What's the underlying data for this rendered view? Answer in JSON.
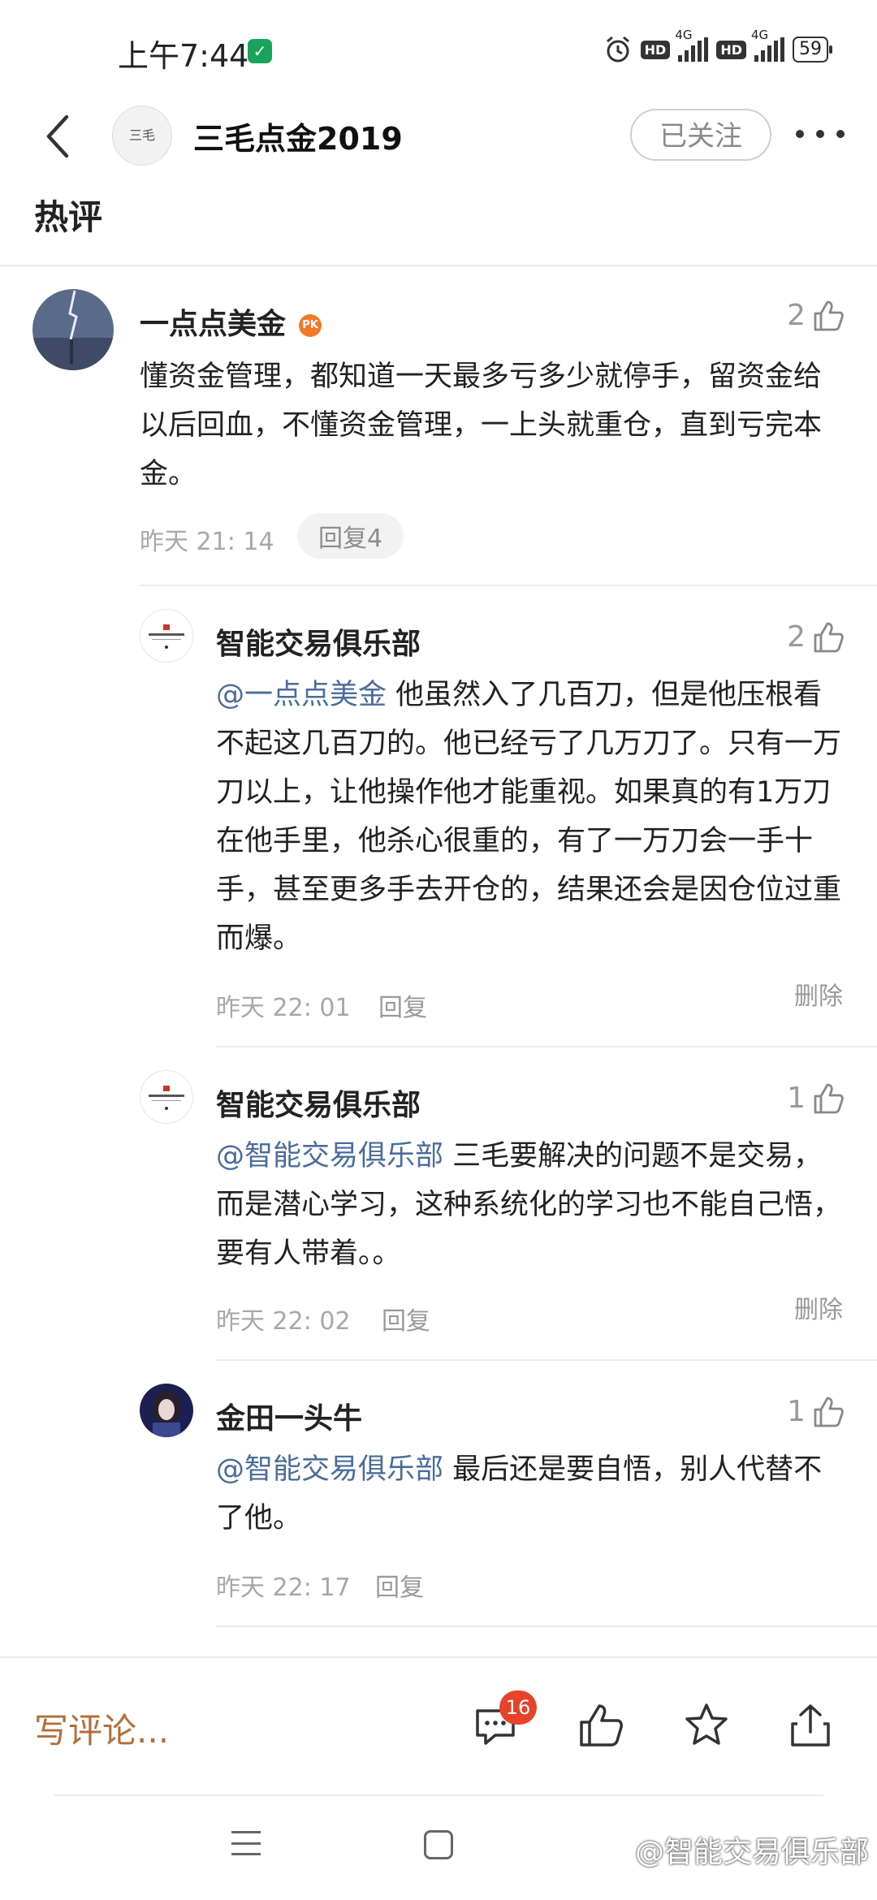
{
  "status_bar": {
    "time": "上午7:44",
    "hd1": "HD",
    "net1": "4G",
    "hd2": "HD",
    "net2": "4G",
    "battery": "59"
  },
  "header": {
    "avatar_text": "三毛",
    "title": "三毛点金2019",
    "follow_label": "已关注",
    "section": "热评"
  },
  "comment": {
    "author": "一点点美金",
    "pk_badge": "PK",
    "likes": "2",
    "text": "懂资金管理，都知道一天最多亏多少就停手，留资金给以后回血，不懂资金管理，一上头就重仓，直到亏完本金。",
    "time": "昨天 21: 14",
    "reply_label": "回复4"
  },
  "replies": [
    {
      "author": "智能交易俱乐部",
      "likes": "2",
      "mention": "@一点点美金",
      "text": " 他虽然入了几百刀，但是他压根看不起这几百刀的。他已经亏了几万刀了。只有一万刀以上，让他操作他才能重视。如果真的有1万刀在他手里，他杀心很重的，有了一万刀会一手十手，甚至更多手去开仓的，结果还会是因仓位过重而爆。",
      "time": "昨天 22: 01",
      "reply_label": "回复",
      "delete_label": "删除"
    },
    {
      "author": "智能交易俱乐部",
      "likes": "1",
      "mention": "@智能交易俱乐部",
      "text": " 三毛要解决的问题不是交易，而是潜心学习，这种系统化的学习也不能自己悟，要有人带着。。",
      "time": "昨天 22: 02",
      "reply_label": "回复",
      "delete_label": "删除"
    },
    {
      "author": "金田一头牛",
      "likes": "1",
      "mention": "@智能交易俱乐部",
      "text": " 最后还是要自悟，别人代替不了他。",
      "time": "昨天 22: 17",
      "reply_label": "回复"
    }
  ],
  "bottom_bar": {
    "write_placeholder": "写评论...",
    "comment_count": "16"
  },
  "watermark": "@智能交易俱乐部",
  "colors": {
    "mention": "#4a6c9a",
    "write": "#b06f3a",
    "badge": "#e6432a"
  }
}
